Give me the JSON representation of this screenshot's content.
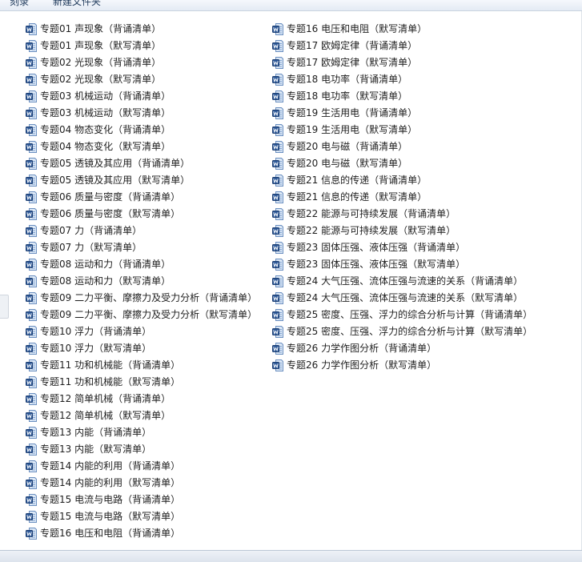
{
  "toolbar": {
    "burn_label": "刻录",
    "new_folder_label": "新建文件夹"
  },
  "icon_name": "word-document-icon",
  "colors": {
    "icon_blue": "#2b5797",
    "icon_light": "#dce8f6",
    "toolbar_bg": "#e9eff6"
  },
  "files": {
    "column_1": [
      "专题01 声现象（背诵清单）",
      "专题01 声现象（默写清单）",
      "专题02 光现象（背诵清单）",
      "专题02 光现象（默写清单）",
      "专题03 机械运动（背诵清单）",
      "专题03 机械运动（默写清单）",
      "专题04 物态变化（背诵清单）",
      "专题04 物态变化（默写清单）",
      "专题05 透镜及其应用（背诵清单）",
      "专题05 透镜及其应用（默写清单）",
      "专题06 质量与密度（背诵清单）",
      "专题06 质量与密度（默写清单）",
      "专题07 力（背诵清单）",
      "专题07 力（默写清单）",
      "专题08 运动和力（背诵清单）",
      "专题08 运动和力（默写清单）",
      "专题09 二力平衡、摩擦力及受力分析（背诵清单）",
      "专题09 二力平衡、摩擦力及受力分析（默写清单）",
      "专题10 浮力（背诵清单）",
      "专题10 浮力（默写清单）",
      "专题11 功和机械能（背诵清单）",
      "专题11 功和机械能（默写清单）",
      "专题12 简单机械（背诵清单）",
      "专题12 简单机械（默写清单）",
      "专题13 内能（背诵清单）",
      "专题13 内能（默写清单）",
      "专题14 内能的利用（背诵清单）",
      "专题14 内能的利用（默写清单）",
      "专题15 电流与电路（背诵清单）",
      "专题15 电流与电路（默写清单）",
      "专题16 电压和电阻（背诵清单）"
    ],
    "column_2": [
      "专题16 电压和电阻（默写清单）",
      "专题17 欧姆定律（背诵清单）",
      "专题17 欧姆定律（默写清单）",
      "专题18 电功率（背诵清单）",
      "专题18 电功率（默写清单）",
      "专题19 生活用电（背诵清单）",
      "专题19 生活用电（默写清单）",
      "专题20 电与磁（背诵清单）",
      "专题20 电与磁（默写清单）",
      "专题21 信息的传递（背诵清单）",
      "专题21 信息的传递（默写清单）",
      "专题22 能源与可持续发展（背诵清单）",
      "专题22 能源与可持续发展（默写清单）",
      "专题23 固体压强、液体压强（背诵清单）",
      "专题23 固体压强、液体压强（默写清单）",
      "专题24 大气压强、流体压强与流速的关系（背诵清单）",
      "专题24 大气压强、流体压强与流速的关系（默写清单）",
      "专题25 密度、压强、浮力的综合分析与计算（背诵清单）",
      "专题25 密度、压强、浮力的综合分析与计算（默写清单）",
      "专题26 力学作图分析（背诵清单）",
      "专题26 力学作图分析（默写清单）"
    ]
  }
}
